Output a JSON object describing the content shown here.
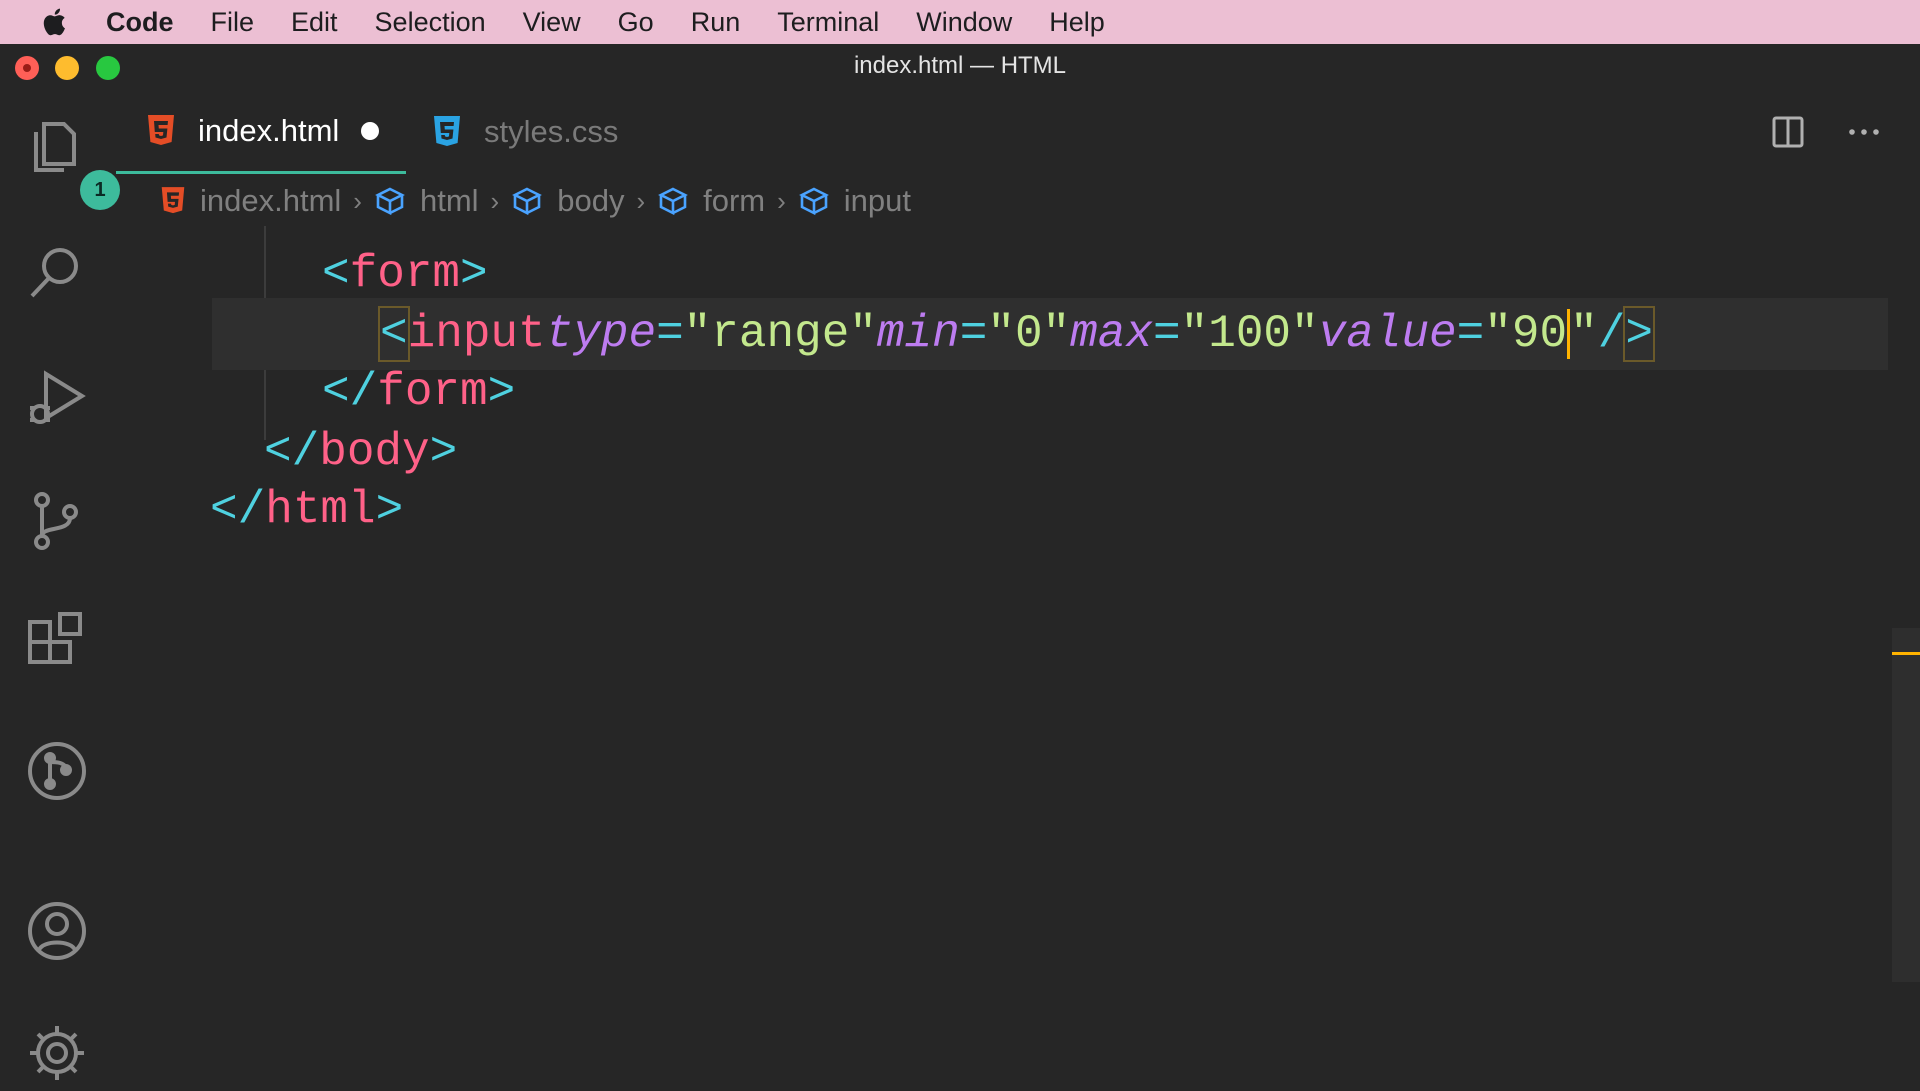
{
  "menubar": {
    "app": "Code",
    "items": [
      "File",
      "Edit",
      "Selection",
      "View",
      "Go",
      "Run",
      "Terminal",
      "Window",
      "Help"
    ]
  },
  "window": {
    "title": "index.html — HTML"
  },
  "activity": {
    "explorer_badge": "1"
  },
  "tabs": [
    {
      "label": "index.html",
      "dirty": true
    },
    {
      "label": "styles.css",
      "dirty": false
    }
  ],
  "breadcrumbs": [
    "index.html",
    "html",
    "body",
    "form",
    "input"
  ],
  "code": {
    "line1": {
      "open": "<",
      "tag": "form",
      "close": ">"
    },
    "line2": {
      "open": "<",
      "tag": "input",
      "attr1": "type",
      "eq": "=",
      "val1": "\"range\"",
      "attr2": "min",
      "val2": "\"0\"",
      "attr3": "max",
      "val3": "\"100\"",
      "attr4": "value",
      "val4a": "\"90",
      "val4b": "\"",
      "selfclose_slash": "/",
      "selfclose_gt": ">"
    },
    "line3": {
      "open": "</",
      "tag": "form",
      "close": ">"
    },
    "line4": {
      "open": "</",
      "tag": "body",
      "close": ">"
    },
    "line5": {
      "open": "</",
      "tag": "html",
      "close": ">"
    }
  },
  "colors": {
    "accent": "#3dbb9c",
    "punctuation": "#4fd1e0",
    "tag": "#ff6188",
    "attribute": "#bd7cf0",
    "string": "#c3e88d",
    "cursor": "#ffb300"
  },
  "icons": {
    "activity": [
      "files-icon",
      "search-icon",
      "run-debug-icon",
      "source-control-icon",
      "extensions-icon",
      "git-graph-icon",
      "account-icon",
      "settings-gear-icon"
    ],
    "tabs": [
      "html5-icon",
      "css3-icon"
    ],
    "actions": [
      "split-editor-icon",
      "more-actions-icon"
    ]
  }
}
